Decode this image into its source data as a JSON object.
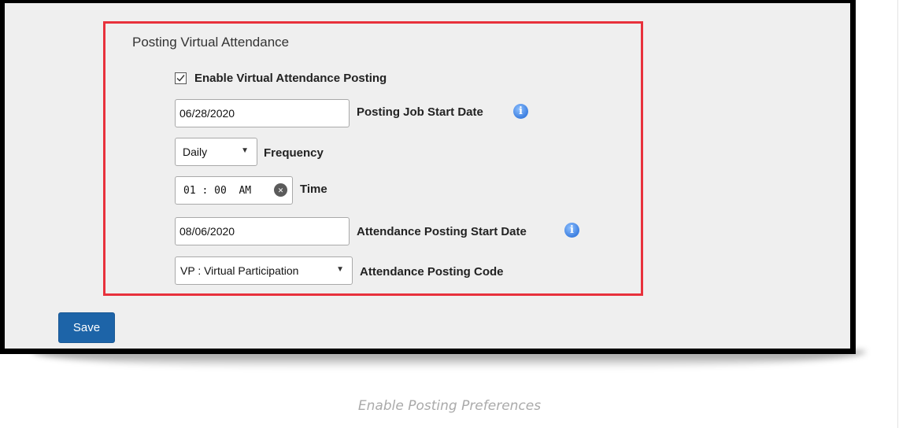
{
  "section": {
    "title": "Posting Virtual Attendance"
  },
  "enable_posting": {
    "label": "Enable Virtual Attendance Posting",
    "checked": true
  },
  "posting_job_start_date": {
    "value": "06/28/2020",
    "label": "Posting Job Start Date"
  },
  "frequency": {
    "selected": "Daily",
    "label": "Frequency"
  },
  "time": {
    "value": "01 : 00  AM",
    "label": "Time"
  },
  "attendance_posting_start_date": {
    "value": "08/06/2020",
    "label": "Attendance Posting Start Date"
  },
  "attendance_posting_code": {
    "selected": "VP : Virtual Participation",
    "label": "Attendance Posting Code"
  },
  "actions": {
    "save_label": "Save"
  },
  "caption": "Enable Posting Preferences",
  "icons": {
    "info": "info-icon",
    "clear": "clear-icon",
    "dropdown": "chevron-down-icon",
    "check": "checkmark-icon"
  },
  "colors": {
    "highlight": "#e8313c",
    "primary_button": "#1d64a8",
    "info_icon": "#3d7fe0"
  }
}
